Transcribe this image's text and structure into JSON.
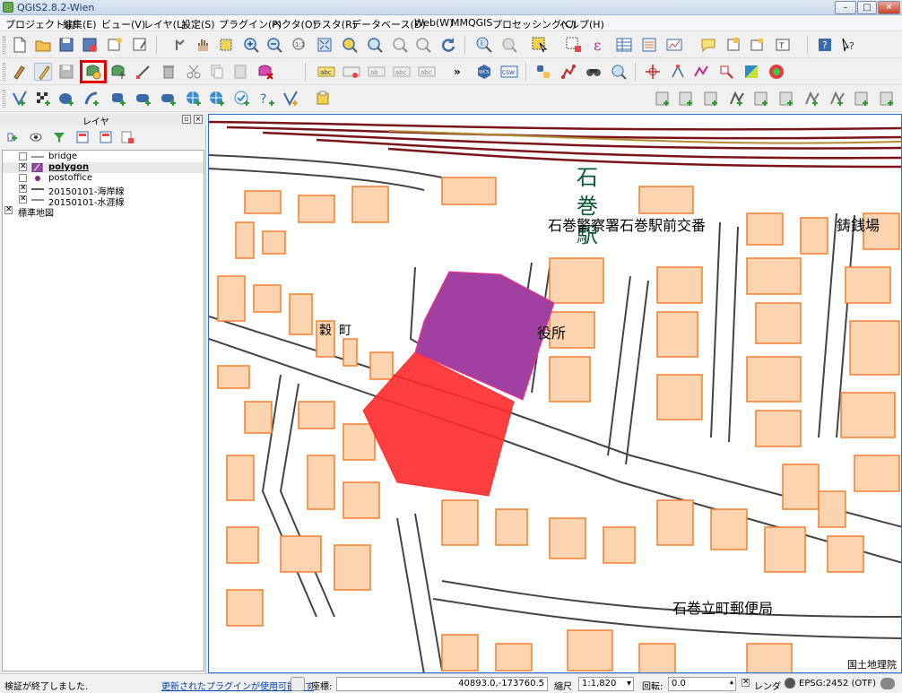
{
  "window": {
    "title": "QGIS2.8.2-Wien",
    "min": "–",
    "max": "□",
    "close": "✕"
  },
  "menu": [
    "プロジェクト(J)",
    "編集(E)",
    "ビュー(V)",
    "レイヤ(L)",
    "設定(S)",
    "プラグイン(P)",
    "ベクタ(O)",
    "ラスタ(R)",
    "データベース(D)",
    "Web(W)",
    "MMQGIS",
    "プロセッシング(C)",
    "ヘルプ(H)"
  ],
  "toolbar_more": "»",
  "highlight_color": "#e00000",
  "layers_panel": {
    "title": "レイヤ",
    "layers": [
      {
        "name": "bridge",
        "checked": false,
        "symbol": "line-gray"
      },
      {
        "name": "polygon",
        "checked": true,
        "symbol": "fill-purple",
        "selected": true
      },
      {
        "name": "postoffice",
        "checked": false,
        "symbol": "point-purple"
      },
      {
        "name": "20150101-海岸線",
        "checked": true,
        "symbol": "line-black"
      },
      {
        "name": "20150101-水涯線",
        "checked": true,
        "symbol": "line-black"
      },
      {
        "name": "標準地図",
        "checked": true,
        "symbol": "none"
      }
    ]
  },
  "map": {
    "labels": {
      "station_1": "石",
      "station_2": "巻",
      "station_3": "駅",
      "police": "石巻警察署石巻駅前交番",
      "casting": "鋳銭場",
      "town": "穀町",
      "cityhall": "役所",
      "postoffice": "石巻立町郵便局",
      "attribution": "国土地理院"
    },
    "colors": {
      "polygon_purple": "#a040a0",
      "polygon_red": "#ff2a2a",
      "building_fill": "#fdd4b0",
      "building_edge": "#f08030",
      "rail": "#7a1418"
    }
  },
  "status": {
    "message": "検証が終了しました.",
    "plugin_link": "更新されたプラグインが使用可能です",
    "coord_label": "座標:",
    "coord_value": "40893.0,-173760.5",
    "scale_label": "縮尺",
    "scale_value": "1:1,820",
    "rotation_label": "回転:",
    "rotation_value": "0.0",
    "render_label": "レンダ",
    "crs": "EPSG:2452 (OTF)"
  }
}
